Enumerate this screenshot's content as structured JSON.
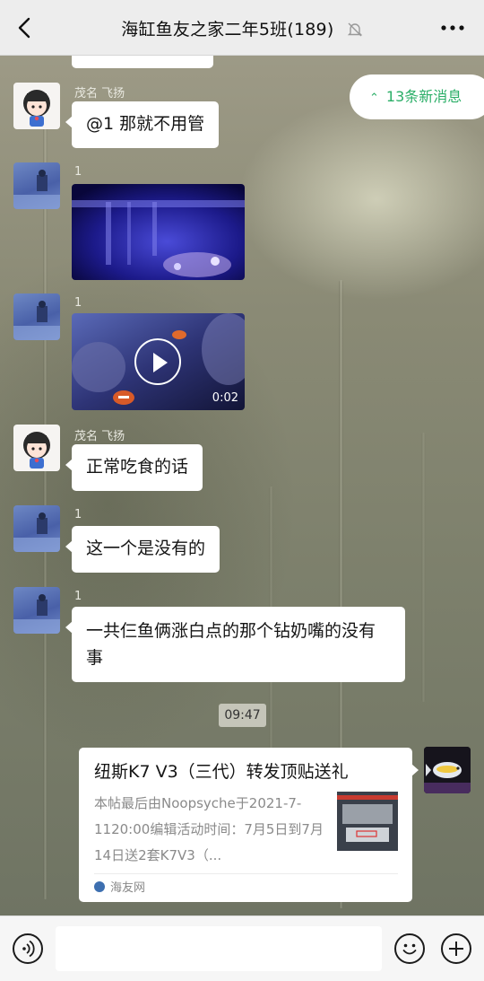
{
  "header": {
    "title": "海缸鱼友之家二年5班(189)"
  },
  "new_messages": {
    "label": "13条新消息"
  },
  "messages": [
    {
      "sender": "茂名 飞扬",
      "text": "@1  那就不用管"
    },
    {
      "sender": "1"
    },
    {
      "sender": "1",
      "video_duration": "0:02"
    },
    {
      "sender": "茂名 飞扬",
      "text": "正常吃食的话"
    },
    {
      "sender": "1",
      "text": "这一个是没有的"
    },
    {
      "sender": "1",
      "text": "一共仨鱼俩涨白点的那个钻奶嘴的没有事"
    }
  ],
  "timestamp": "09:47",
  "link_card": {
    "title": "纽斯K7 V3（三代）转发顶贴送礼",
    "description": "本帖最后由Noopsyche于2021-7-1120:00编辑活动时间：7月5日到7月14日送2套K7V3（...",
    "source": "海友网"
  },
  "input": {
    "placeholder": ""
  },
  "colors": {
    "accent_green": "#2aae67",
    "header_bg": "#ededed"
  }
}
